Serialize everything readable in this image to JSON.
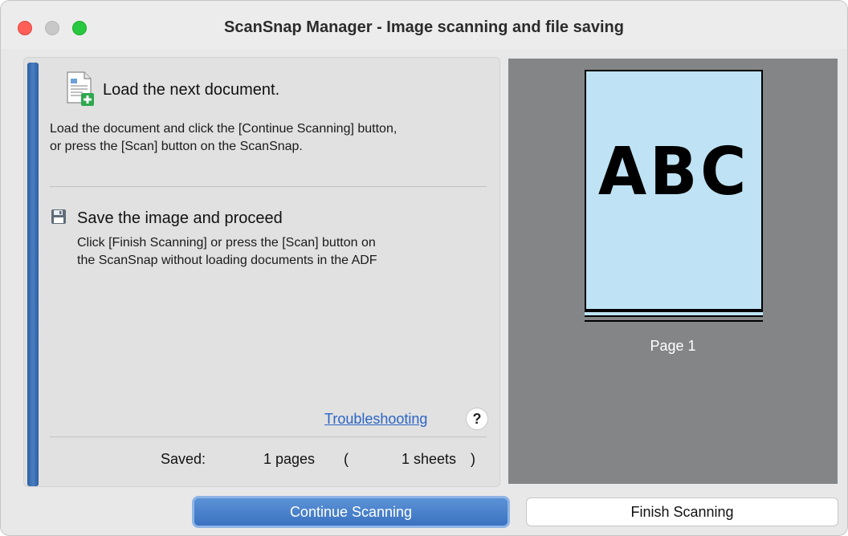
{
  "window": {
    "title": "ScanSnap Manager - Image scanning and file saving"
  },
  "steps": {
    "load": {
      "icon": "document-add-icon",
      "heading": "Load the next document.",
      "line1": "Load the document and click the [Continue Scanning] button,",
      "line2": "or press the [Scan] button on the ScanSnap."
    },
    "save": {
      "icon": "floppy-disk-icon",
      "heading": "Save the image and proceed",
      "line1": "Click [Finish Scanning] or press the [Scan] button on",
      "line2": "the ScanSnap without loading documents in the ADF"
    }
  },
  "help": {
    "troubleshooting_label": "Troubleshooting",
    "help_symbol": "?"
  },
  "status": {
    "saved_label": "Saved:",
    "pages_count": "1",
    "pages_unit": "pages",
    "paren_open": "(",
    "sheets_count": "1",
    "sheets_unit": "sheets",
    "paren_close": ")"
  },
  "preview": {
    "page_text": "ABC",
    "page_caption": "Page 1",
    "page_color": "#bfe3f4",
    "background_color": "#838587"
  },
  "buttons": {
    "continue_label": "Continue Scanning",
    "finish_label": "Finish Scanning"
  },
  "colors": {
    "accent": "#3a72c1",
    "link": "#2a64c4",
    "progress_bar": "#2d5fa0"
  }
}
